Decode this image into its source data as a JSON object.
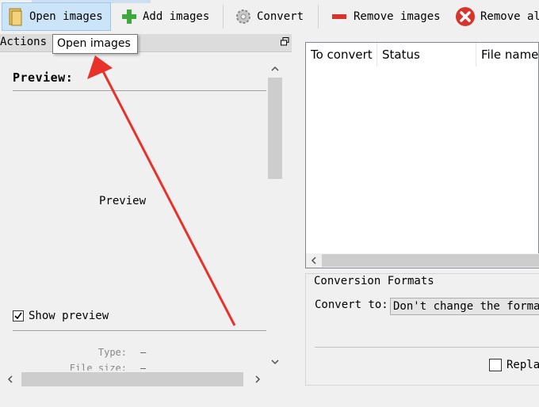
{
  "toolbar": {
    "open_images": "Open images",
    "add_images": "Add images",
    "convert": "Convert",
    "remove_images": "Remove images",
    "remove_all": "Remove all"
  },
  "tooltip": "Open images",
  "actions_panel": {
    "title": "Actions P",
    "preview_title": "Preview:",
    "preview_placeholder": "Preview",
    "show_preview_label": "Show preview",
    "show_preview_checked": true,
    "type_label": "Type:",
    "type_value": "–",
    "file_size_label": "File size:",
    "file_size_value": "–"
  },
  "file_list": {
    "columns": [
      "To convert",
      "Status",
      "File name"
    ]
  },
  "conversion_formats": {
    "title": "Conversion Formats",
    "convert_to_label": "Convert to:",
    "convert_to_value": "Don't change the format",
    "replace_label": "Repla"
  },
  "colors": {
    "accent_red": "#e8312a",
    "active_button_bg": "#cce4f7"
  }
}
